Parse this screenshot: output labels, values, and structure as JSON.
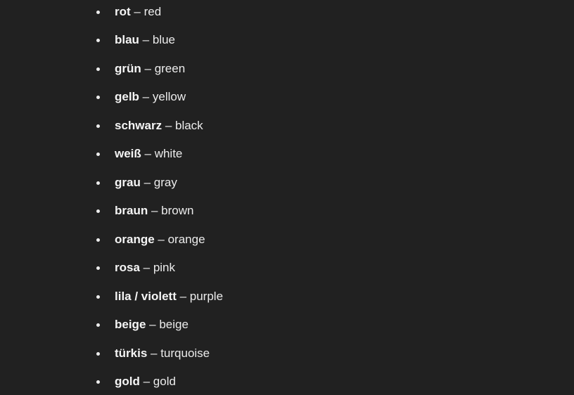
{
  "separator": " – ",
  "items": [
    {
      "term": "rot",
      "translation": "red"
    },
    {
      "term": "blau",
      "translation": "blue"
    },
    {
      "term": "grün",
      "translation": "green"
    },
    {
      "term": "gelb",
      "translation": "yellow"
    },
    {
      "term": "schwarz",
      "translation": "black"
    },
    {
      "term": "weiß",
      "translation": "white"
    },
    {
      "term": "grau",
      "translation": "gray"
    },
    {
      "term": "braun",
      "translation": "brown"
    },
    {
      "term": "orange",
      "translation": "orange"
    },
    {
      "term": "rosa",
      "translation": "pink"
    },
    {
      "term": "lila / violett",
      "translation": "purple"
    },
    {
      "term": "beige",
      "translation": "beige"
    },
    {
      "term": "türkis",
      "translation": "turquoise"
    },
    {
      "term": "gold",
      "translation": "gold"
    }
  ]
}
